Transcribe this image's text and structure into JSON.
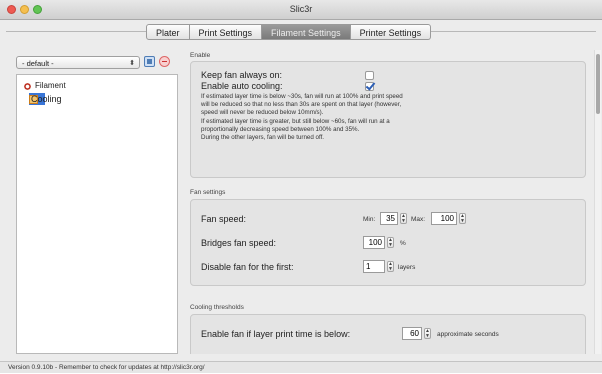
{
  "window": {
    "title": "Slic3r"
  },
  "tabs": [
    {
      "label": "Plater"
    },
    {
      "label": "Print Settings"
    },
    {
      "label": "Filament Settings"
    },
    {
      "label": "Printer Settings"
    }
  ],
  "active_tab": "Filament Settings",
  "preset": {
    "selected": "- default -"
  },
  "tree": {
    "items": [
      {
        "label": "Filament",
        "icon": "filament-icon"
      },
      {
        "label": "Cooling",
        "icon": "cooling-icon",
        "selected": true
      }
    ]
  },
  "enable": {
    "title": "Enable",
    "keep_fan_label": "Keep fan always on:",
    "keep_fan_checked": false,
    "auto_cool_label": "Enable auto cooling:",
    "auto_cool_checked": true,
    "description_lines": [
      "If estimated layer time is below ~30s, fan will run at 100% and print speed",
      "will be reduced so that no less than 30s are spent on that layer (however,",
      "speed will never be reduced below 10mm/s).",
      "If estimated layer time is greater, but still below ~60s, fan will run at a",
      "proportionally decreasing speed between 100% and 35%.",
      "During the other layers, fan will be turned off."
    ]
  },
  "fan": {
    "title": "Fan settings",
    "speed_label": "Fan speed:",
    "min_label": "Min:",
    "min_value": "35",
    "max_label": "Max:",
    "max_value": "100",
    "bridges_label": "Bridges fan speed:",
    "bridges_value": "100",
    "bridges_unit": "%",
    "disable_label": "Disable fan for the first:",
    "disable_value": "1",
    "disable_unit": "layers"
  },
  "cooling": {
    "title": "Cooling thresholds",
    "enable_label": "Enable fan if layer print time is below:",
    "enable_value": "60",
    "enable_unit": "approximate seconds"
  },
  "status": {
    "text": "Version 0.9.10b - Remember to check for updates at http://slic3r.org/"
  }
}
